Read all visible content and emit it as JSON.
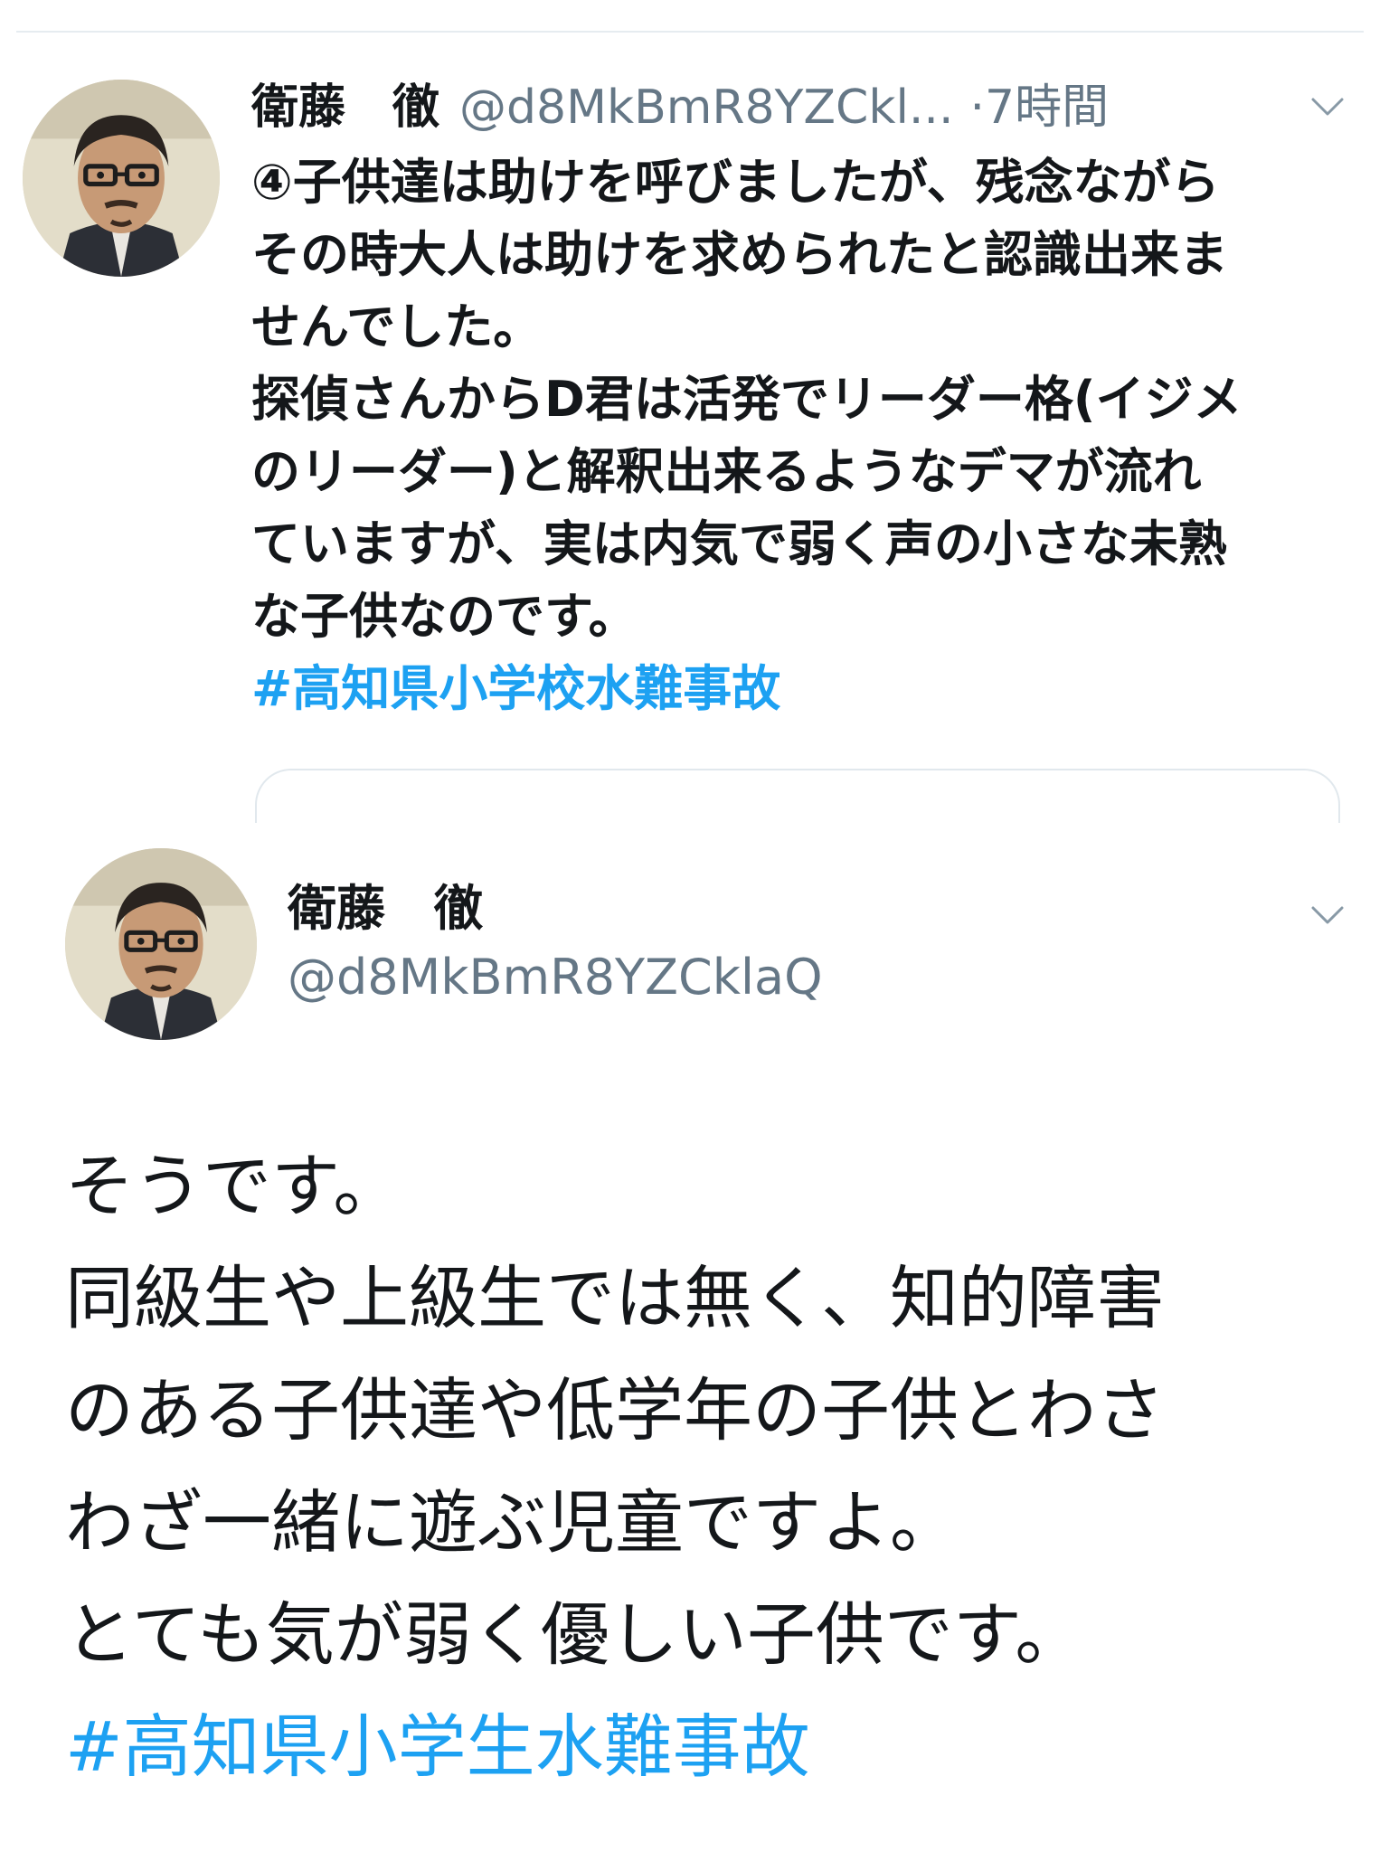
{
  "parent_tweet": {
    "display_name": "衛藤　徹",
    "handle": "@d8MkBmR8YZCkl...",
    "time": "·7時間",
    "lines": [
      "④子供達は助けを呼びましたが、残念ながら",
      "その時大人は助けを求められたと認識出来ま",
      "せんでした。",
      "探偵さんからD君は活発でリーダー格(イジメ",
      "のリーダー)と解釈出来るようなデマが流れ",
      "ていますが、実は内気で弱く声の小さな未熟",
      "な子供なのです。"
    ],
    "hashtag": "#高知県小学校水難事故",
    "avatar_icon": "user-avatar-photo",
    "menu_icon": "chevron-down-icon"
  },
  "main_tweet": {
    "display_name": "衛藤　徹",
    "handle": "@d8MkBmR8YZCklaQ",
    "lines": [
      "そうです。",
      "同級生や上級生では無く、知的障害",
      "のある子供達や低学年の子供とわさ",
      "わざ一緒に遊ぶ児童ですよ。",
      "とても気が弱く優しい子供です。"
    ],
    "hashtag": "#高知県小学生水難事故",
    "avatar_icon": "user-avatar-photo",
    "menu_icon": "chevron-down-icon"
  },
  "colors": {
    "text": "#14171a",
    "secondary": "#657786",
    "link": "#1da1f2",
    "divider": "#e6ecf0"
  }
}
